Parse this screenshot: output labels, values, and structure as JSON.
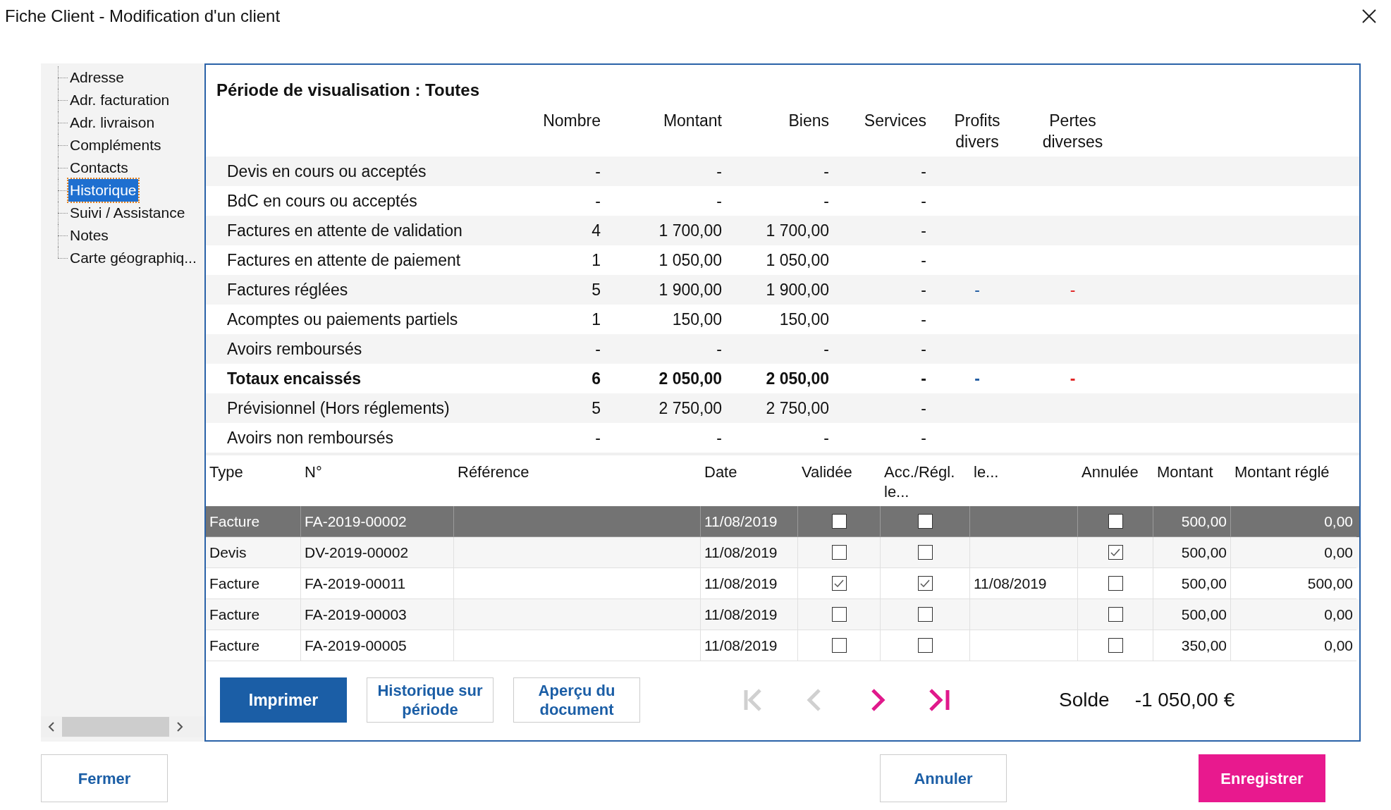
{
  "window": {
    "title": "Fiche Client - Modification d'un client"
  },
  "sidebar": {
    "items": [
      {
        "label": "Adresse",
        "selected": false
      },
      {
        "label": "Adr. facturation",
        "selected": false
      },
      {
        "label": "Adr. livraison",
        "selected": false
      },
      {
        "label": "Compléments",
        "selected": false
      },
      {
        "label": "Contacts",
        "selected": false
      },
      {
        "label": "Historique",
        "selected": true
      },
      {
        "label": "Suivi / Assistance",
        "selected": false
      },
      {
        "label": "Notes",
        "selected": false
      },
      {
        "label": "Carte géographiq..."
      }
    ]
  },
  "summary": {
    "title": "Période de visualisation : Toutes",
    "columns": [
      "Nombre",
      "Montant",
      "Biens",
      "Services",
      "Profits divers",
      "Pertes diverses"
    ],
    "rows": [
      {
        "label": "Devis en cours ou acceptés",
        "bold": false,
        "cells": [
          "-",
          "-",
          "-",
          "-"
        ]
      },
      {
        "label": "BdC en cours ou acceptés",
        "bold": false,
        "cells": [
          "-",
          "-",
          "-",
          "-"
        ]
      },
      {
        "label": "Factures en attente de validation",
        "bold": false,
        "cells": [
          "4",
          "1 700,00",
          "1 700,00",
          "-"
        ]
      },
      {
        "label": "Factures en attente de paiement",
        "bold": false,
        "cells": [
          "1",
          "1 050,00",
          "1 050,00",
          "-"
        ]
      },
      {
        "label": "Factures réglées",
        "bold": false,
        "cells": [
          "5",
          "1 900,00",
          "1 900,00",
          "-",
          "-",
          "-"
        ]
      },
      {
        "label": "Acomptes ou paiements partiels",
        "bold": false,
        "cells": [
          "1",
          "150,00",
          "150,00",
          "-"
        ]
      },
      {
        "label": "Avoirs remboursés",
        "bold": false,
        "cells": [
          "-",
          "-",
          "-",
          "-"
        ]
      },
      {
        "label": "Totaux encaissés",
        "bold": true,
        "cells": [
          "6",
          "2 050,00",
          "2 050,00",
          "-",
          "-",
          "-"
        ]
      },
      {
        "label": "Prévisionnel (Hors réglements)",
        "bold": false,
        "cells": [
          "5",
          "2 750,00",
          "2 750,00",
          "-"
        ]
      },
      {
        "label": "Avoirs non remboursés",
        "bold": false,
        "cells": [
          "-",
          "-",
          "-",
          "-"
        ]
      }
    ]
  },
  "documents": {
    "columns": [
      "Type",
      "N°",
      "Référence",
      "Date",
      "Validée",
      "Acc./Régl. le...",
      "le...",
      "Annulée",
      "Montant",
      "Montant réglé"
    ],
    "rows": [
      {
        "selected": true,
        "type": "Facture",
        "number": "FA-2019-00002",
        "date": "11/08/2019",
        "validated": false,
        "accepted": false,
        "cancelled": false,
        "amount": "500,00",
        "paid": "0,00"
      },
      {
        "selected": false,
        "type": "Devis",
        "number": "DV-2019-00002",
        "date": "11/08/2019",
        "validated": false,
        "accepted": false,
        "cancelled": true,
        "amount": "500,00",
        "paid": "0,00"
      },
      {
        "selected": false,
        "type": "Facture",
        "number": "FA-2019-00011",
        "date": "11/08/2019",
        "validated": true,
        "accepted": true,
        "paid_date": "11/08/2019",
        "cancelled": false,
        "amount": "500,00",
        "paid": "500,00"
      },
      {
        "selected": false,
        "type": "Facture",
        "number": "FA-2019-00003",
        "date": "11/08/2019",
        "validated": false,
        "accepted": false,
        "cancelled": false,
        "amount": "500,00",
        "paid": "0,00"
      },
      {
        "selected": false,
        "type": "Facture",
        "number": "FA-2019-00005",
        "date": "11/08/2019",
        "validated": false,
        "accepted": false,
        "cancelled": false,
        "amount": "350,00",
        "paid": "0,00"
      }
    ]
  },
  "actions": {
    "print": "Imprimer",
    "history": "Historique sur période",
    "preview": "Aperçu du document"
  },
  "navigation": [
    {
      "kind": "first",
      "disabled": true
    },
    {
      "kind": "prev",
      "disabled": true
    },
    {
      "kind": "next",
      "disabled": false
    },
    {
      "kind": "last",
      "disabled": false
    }
  ],
  "balance": {
    "label": "Solde",
    "value": "-1 050,00 €"
  },
  "footer": {
    "close": "Fermer",
    "cancel": "Annuler",
    "save": "Enregistrer"
  }
}
